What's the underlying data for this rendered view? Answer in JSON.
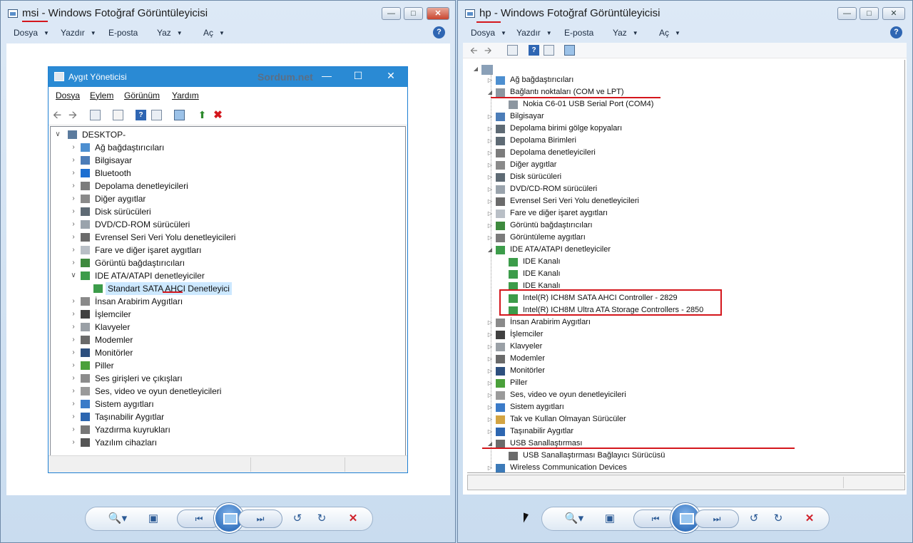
{
  "left_window": {
    "title_prefix": "msi",
    "title_rest": " - Windows Fotoğraf Görüntüleyicisi",
    "menu": [
      "Dosya",
      "Yazdır",
      "E-posta",
      "Yaz",
      "Aç"
    ]
  },
  "right_window": {
    "title_prefix": "hp",
    "title_rest": " - Windows Fotoğraf Görüntüleyicisi",
    "menu": [
      "Dosya",
      "Yazdır",
      "E-posta",
      "Yaz",
      "Aç"
    ]
  },
  "help_glyph": "?",
  "win10_dm": {
    "title": "Aygıt Yöneticisi",
    "watermark": "Sordum.net",
    "menu": [
      "Dosya",
      "Eylem",
      "Görünüm",
      "Yardım"
    ],
    "root": "DESKTOP-",
    "items": [
      {
        "label": "Ağ bağdaştırıcıları",
        "icon": "network-adapter-icon",
        "expanded": false,
        "level": 1
      },
      {
        "label": "Bilgisayar",
        "icon": "computer-icon",
        "expanded": false,
        "level": 1
      },
      {
        "label": "Bluetooth",
        "icon": "bluetooth-icon",
        "expanded": false,
        "level": 1
      },
      {
        "label": "Depolama denetleyicileri",
        "icon": "storage-controller-icon",
        "expanded": false,
        "level": 1
      },
      {
        "label": "Diğer aygıtlar",
        "icon": "other-devices-icon",
        "expanded": false,
        "level": 1
      },
      {
        "label": "Disk sürücüleri",
        "icon": "disk-drive-icon",
        "expanded": false,
        "level": 1
      },
      {
        "label": "DVD/CD-ROM sürücüleri",
        "icon": "dvd-icon",
        "expanded": false,
        "level": 1
      },
      {
        "label": "Evrensel Seri Veri Yolu denetleyicileri",
        "icon": "usb-icon",
        "expanded": false,
        "level": 1
      },
      {
        "label": "Fare ve diğer işaret aygıtları",
        "icon": "mouse-icon",
        "expanded": false,
        "level": 1
      },
      {
        "label": "Görüntü bağdaştırıcıları",
        "icon": "display-adapter-icon",
        "expanded": false,
        "level": 1
      },
      {
        "label": "IDE ATA/ATAPI denetleyiciler",
        "icon": "ide-controller-icon",
        "expanded": true,
        "level": 1
      },
      {
        "label": "Standart SATA AHCI Denetleyici",
        "icon": "ide-controller-icon",
        "expanded": null,
        "level": 2,
        "selected": true
      },
      {
        "label": "İnsan Arabirim Aygıtları",
        "icon": "hid-icon",
        "expanded": false,
        "level": 1
      },
      {
        "label": "İşlemciler",
        "icon": "processor-icon",
        "expanded": false,
        "level": 1
      },
      {
        "label": "Klavyeler",
        "icon": "keyboard-icon",
        "expanded": false,
        "level": 1
      },
      {
        "label": "Modemler",
        "icon": "modem-icon",
        "expanded": false,
        "level": 1
      },
      {
        "label": "Monitörler",
        "icon": "monitor-icon",
        "expanded": false,
        "level": 1
      },
      {
        "label": "Piller",
        "icon": "battery-icon",
        "expanded": false,
        "level": 1
      },
      {
        "label": "Ses girişleri ve çıkışları",
        "icon": "audio-io-icon",
        "expanded": false,
        "level": 1
      },
      {
        "label": "Ses, video ve oyun denetleyicileri",
        "icon": "sound-icon",
        "expanded": false,
        "level": 1
      },
      {
        "label": "Sistem aygıtları",
        "icon": "system-devices-icon",
        "expanded": false,
        "level": 1
      },
      {
        "label": "Taşınabilir Aygıtlar",
        "icon": "portable-devices-icon",
        "expanded": false,
        "level": 1
      },
      {
        "label": "Yazdırma kuyrukları",
        "icon": "printer-icon",
        "expanded": false,
        "level": 1
      },
      {
        "label": "Yazılım cihazları",
        "icon": "software-device-icon",
        "expanded": false,
        "level": 1
      }
    ]
  },
  "win7_dm": {
    "items": [
      {
        "label": "Ağ bağdaştırıcıları",
        "icon": "network-adapter-icon",
        "expanded": false,
        "level": 1
      },
      {
        "label": "Bağlantı noktaları (COM ve LPT)",
        "icon": "port-icon",
        "expanded": true,
        "level": 1
      },
      {
        "label": "Nokia C6-01 USB Serial Port (COM4)",
        "icon": "port-icon",
        "expanded": null,
        "level": 2
      },
      {
        "label": "Bilgisayar",
        "icon": "computer-icon",
        "expanded": false,
        "level": 1
      },
      {
        "label": "Depolama birimi gölge kopyaları",
        "icon": "disk-drive-icon",
        "expanded": false,
        "level": 1
      },
      {
        "label": "Depolama Birimleri",
        "icon": "disk-drive-icon",
        "expanded": false,
        "level": 1
      },
      {
        "label": "Depolama denetleyicileri",
        "icon": "storage-controller-icon",
        "expanded": false,
        "level": 1
      },
      {
        "label": "Diğer aygıtlar",
        "icon": "other-devices-icon",
        "expanded": false,
        "level": 1
      },
      {
        "label": "Disk sürücüleri",
        "icon": "disk-drive-icon",
        "expanded": false,
        "level": 1
      },
      {
        "label": "DVD/CD-ROM sürücüleri",
        "icon": "dvd-icon",
        "expanded": false,
        "level": 1
      },
      {
        "label": "Evrensel Seri Veri Yolu denetleyicileri",
        "icon": "usb-icon",
        "expanded": false,
        "level": 1
      },
      {
        "label": "Fare ve diğer işaret aygıtları",
        "icon": "mouse-icon",
        "expanded": false,
        "level": 1
      },
      {
        "label": "Görüntü bağdaştırıcıları",
        "icon": "display-adapter-icon",
        "expanded": false,
        "level": 1
      },
      {
        "label": "Görüntüleme aygıtları",
        "icon": "imaging-icon",
        "expanded": false,
        "level": 1
      },
      {
        "label": "IDE ATA/ATAPI denetleyiciler",
        "icon": "ide-controller-icon",
        "expanded": true,
        "level": 1
      },
      {
        "label": "IDE Kanalı",
        "icon": "ide-controller-icon",
        "expanded": null,
        "level": 2
      },
      {
        "label": "IDE Kanalı",
        "icon": "ide-controller-icon",
        "expanded": null,
        "level": 2
      },
      {
        "label": "IDE Kanalı",
        "icon": "ide-controller-icon",
        "expanded": null,
        "level": 2
      },
      {
        "label": "Intel(R) ICH8M SATA AHCI Controller - 2829",
        "icon": "ide-controller-icon",
        "expanded": null,
        "level": 2
      },
      {
        "label": "Intel(R) ICH8M Ultra ATA Storage Controllers - 2850",
        "icon": "ide-controller-icon",
        "expanded": null,
        "level": 2
      },
      {
        "label": "İnsan Arabirim Aygıtları",
        "icon": "hid-icon",
        "expanded": false,
        "level": 1
      },
      {
        "label": "İşlemciler",
        "icon": "processor-icon",
        "expanded": false,
        "level": 1
      },
      {
        "label": "Klavyeler",
        "icon": "keyboard-icon",
        "expanded": false,
        "level": 1
      },
      {
        "label": "Modemler",
        "icon": "modem-icon",
        "expanded": false,
        "level": 1
      },
      {
        "label": "Monitörler",
        "icon": "monitor-icon",
        "expanded": false,
        "level": 1
      },
      {
        "label": "Piller",
        "icon": "battery-icon",
        "expanded": false,
        "level": 1
      },
      {
        "label": "Ses, video ve oyun denetleyicileri",
        "icon": "sound-icon",
        "expanded": false,
        "level": 1
      },
      {
        "label": "Sistem aygıtları",
        "icon": "system-devices-icon",
        "expanded": false,
        "level": 1
      },
      {
        "label": "Tak ve Kullan Olmayan Sürücüler",
        "icon": "non-pnp-icon",
        "expanded": false,
        "level": 1
      },
      {
        "label": "Taşınabilir Aygıtlar",
        "icon": "portable-devices-icon",
        "expanded": false,
        "level": 1
      },
      {
        "label": "USB Sanallaştırması",
        "icon": "usb-icon",
        "expanded": true,
        "level": 1
      },
      {
        "label": "USB Sanallaştırması Bağlayıcı Sürücüsü",
        "icon": "usb-icon",
        "expanded": null,
        "level": 2
      },
      {
        "label": "Wireless Communication Devices",
        "icon": "wireless-icon",
        "expanded": false,
        "level": 1
      }
    ]
  },
  "colors": {
    "annotation_red": "#d4161c",
    "win10_caption": "#2a8ad4",
    "selection": "#cce8ff"
  }
}
